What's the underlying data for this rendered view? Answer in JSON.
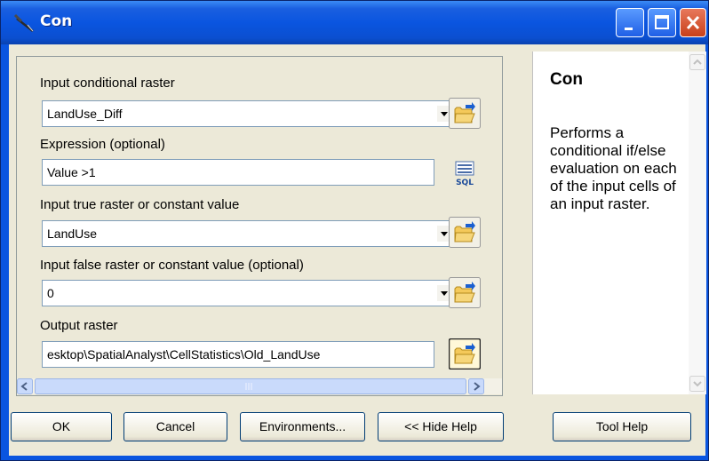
{
  "window": {
    "title": "Con"
  },
  "params": [
    {
      "label": "Input conditional raster",
      "value": "LandUse_Diff"
    },
    {
      "label": "Expression (optional)",
      "value": "Value >1"
    },
    {
      "label": "Input true raster or constant value",
      "value": "LandUse"
    },
    {
      "label": "Input false raster or constant value (optional)",
      "value": "0"
    },
    {
      "label": "Output raster",
      "value": "esktop\\SpatialAnalyst\\CellStatistics\\Old_LandUse"
    }
  ],
  "help": {
    "title": "Con",
    "body": "Performs a conditional if/else evaluation on each of the input cells of an input raster."
  },
  "buttons": {
    "ok": "OK",
    "cancel": "Cancel",
    "environments": "Environments...",
    "hide_help": "<< Hide Help",
    "tool_help": "Tool Help"
  },
  "icons": {
    "browse": "folder-open-icon",
    "sql": "sql-query-icon",
    "dropdown": "chevron-down-icon",
    "tool": "hammer-icon"
  },
  "colors": {
    "titlebar": "#0a55e0",
    "dialog_bg": "#ece9d8",
    "close_button": "#c8401a"
  }
}
